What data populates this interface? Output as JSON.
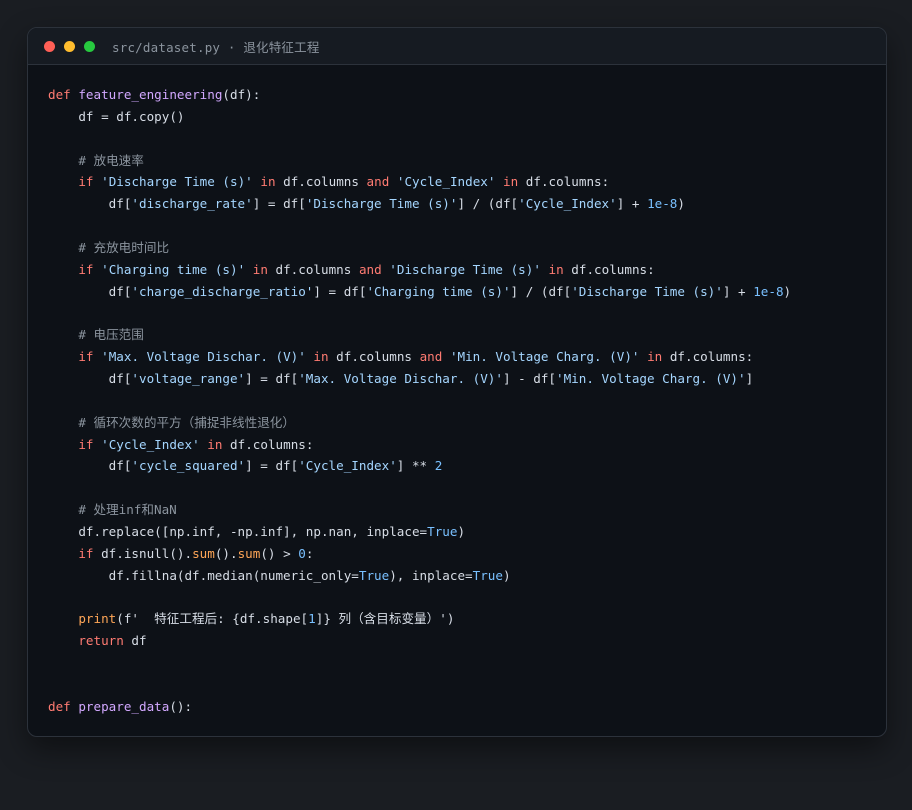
{
  "window": {
    "title": "src/dataset.py · 退化特征工程",
    "controls": {
      "close_color": "#ff5f56",
      "minimize_color": "#ffbd2e",
      "maximize_color": "#27c93f"
    }
  },
  "code_lines": [
    [
      {
        "t": "kw",
        "v": "def"
      },
      {
        "t": "plain",
        "v": " "
      },
      {
        "t": "fn",
        "v": "feature_engineering"
      },
      {
        "t": "plain",
        "v": "(df):"
      }
    ],
    [
      {
        "t": "plain",
        "v": "    df = df.copy()"
      }
    ],
    [],
    [
      {
        "t": "com",
        "v": "    # 放电速率"
      }
    ],
    [
      {
        "t": "plain",
        "v": "    "
      },
      {
        "t": "kw",
        "v": "if"
      },
      {
        "t": "plain",
        "v": " "
      },
      {
        "t": "str",
        "v": "'Discharge Time (s)'"
      },
      {
        "t": "plain",
        "v": " "
      },
      {
        "t": "kw",
        "v": "in"
      },
      {
        "t": "plain",
        "v": " df.columns "
      },
      {
        "t": "kw",
        "v": "and"
      },
      {
        "t": "plain",
        "v": " "
      },
      {
        "t": "str",
        "v": "'Cycle_Index'"
      },
      {
        "t": "plain",
        "v": " "
      },
      {
        "t": "kw",
        "v": "in"
      },
      {
        "t": "plain",
        "v": " df.columns:"
      }
    ],
    [
      {
        "t": "plain",
        "v": "        df["
      },
      {
        "t": "str",
        "v": "'discharge_rate'"
      },
      {
        "t": "plain",
        "v": "] = df["
      },
      {
        "t": "str",
        "v": "'Discharge Time (s)'"
      },
      {
        "t": "plain",
        "v": "] / (df["
      },
      {
        "t": "str",
        "v": "'Cycle_Index'"
      },
      {
        "t": "plain",
        "v": "] + "
      },
      {
        "t": "num",
        "v": "1e-8"
      },
      {
        "t": "plain",
        "v": ")"
      }
    ],
    [],
    [
      {
        "t": "com",
        "v": "    # 充放电时间比"
      }
    ],
    [
      {
        "t": "plain",
        "v": "    "
      },
      {
        "t": "kw",
        "v": "if"
      },
      {
        "t": "plain",
        "v": " "
      },
      {
        "t": "str",
        "v": "'Charging time (s)'"
      },
      {
        "t": "plain",
        "v": " "
      },
      {
        "t": "kw",
        "v": "in"
      },
      {
        "t": "plain",
        "v": " df.columns "
      },
      {
        "t": "kw",
        "v": "and"
      },
      {
        "t": "plain",
        "v": " "
      },
      {
        "t": "str",
        "v": "'Discharge Time (s)'"
      },
      {
        "t": "plain",
        "v": " "
      },
      {
        "t": "kw",
        "v": "in"
      },
      {
        "t": "plain",
        "v": " df.columns:"
      }
    ],
    [
      {
        "t": "plain",
        "v": "        df["
      },
      {
        "t": "str",
        "v": "'charge_discharge_ratio'"
      },
      {
        "t": "plain",
        "v": "] = df["
      },
      {
        "t": "str",
        "v": "'Charging time (s)'"
      },
      {
        "t": "plain",
        "v": "] / (df["
      },
      {
        "t": "str",
        "v": "'Discharge Time (s)'"
      },
      {
        "t": "plain",
        "v": "] + "
      },
      {
        "t": "num",
        "v": "1e-8"
      },
      {
        "t": "plain",
        "v": ")"
      }
    ],
    [],
    [
      {
        "t": "com",
        "v": "    # 电压范围"
      }
    ],
    [
      {
        "t": "plain",
        "v": "    "
      },
      {
        "t": "kw",
        "v": "if"
      },
      {
        "t": "plain",
        "v": " "
      },
      {
        "t": "str",
        "v": "'Max. Voltage Dischar. (V)'"
      },
      {
        "t": "plain",
        "v": " "
      },
      {
        "t": "kw",
        "v": "in"
      },
      {
        "t": "plain",
        "v": " df.columns "
      },
      {
        "t": "kw",
        "v": "and"
      },
      {
        "t": "plain",
        "v": " "
      },
      {
        "t": "str",
        "v": "'Min. Voltage Charg. (V)'"
      },
      {
        "t": "plain",
        "v": " "
      },
      {
        "t": "kw",
        "v": "in"
      },
      {
        "t": "plain",
        "v": " df.columns:"
      }
    ],
    [
      {
        "t": "plain",
        "v": "        df["
      },
      {
        "t": "str",
        "v": "'voltage_range'"
      },
      {
        "t": "plain",
        "v": "] = df["
      },
      {
        "t": "str",
        "v": "'Max. Voltage Dischar. (V)'"
      },
      {
        "t": "plain",
        "v": "] - df["
      },
      {
        "t": "str",
        "v": "'Min. Voltage Charg. (V)'"
      },
      {
        "t": "plain",
        "v": "]"
      }
    ],
    [],
    [
      {
        "t": "com",
        "v": "    # 循环次数的平方（捕捉非线性退化）"
      }
    ],
    [
      {
        "t": "plain",
        "v": "    "
      },
      {
        "t": "kw",
        "v": "if"
      },
      {
        "t": "plain",
        "v": " "
      },
      {
        "t": "str",
        "v": "'Cycle_Index'"
      },
      {
        "t": "plain",
        "v": " "
      },
      {
        "t": "kw",
        "v": "in"
      },
      {
        "t": "plain",
        "v": " df.columns:"
      }
    ],
    [
      {
        "t": "plain",
        "v": "        df["
      },
      {
        "t": "str",
        "v": "'cycle_squared'"
      },
      {
        "t": "plain",
        "v": "] = df["
      },
      {
        "t": "str",
        "v": "'Cycle_Index'"
      },
      {
        "t": "plain",
        "v": "] ** "
      },
      {
        "t": "num",
        "v": "2"
      }
    ],
    [],
    [
      {
        "t": "com",
        "v": "    # 处理inf和NaN"
      }
    ],
    [
      {
        "t": "plain",
        "v": "    df.replace([np.inf, -np.inf], np.nan, inplace="
      },
      {
        "t": "num",
        "v": "True"
      },
      {
        "t": "plain",
        "v": ")"
      }
    ],
    [
      {
        "t": "plain",
        "v": "    "
      },
      {
        "t": "kw",
        "v": "if"
      },
      {
        "t": "plain",
        "v": " df.isnull()."
      },
      {
        "t": "bi",
        "v": "sum"
      },
      {
        "t": "plain",
        "v": "()."
      },
      {
        "t": "bi",
        "v": "sum"
      },
      {
        "t": "plain",
        "v": "() > "
      },
      {
        "t": "num",
        "v": "0"
      },
      {
        "t": "plain",
        "v": ":"
      }
    ],
    [
      {
        "t": "plain",
        "v": "        df.fillna(df.median(numeric_only="
      },
      {
        "t": "num",
        "v": "True"
      },
      {
        "t": "plain",
        "v": "), inplace="
      },
      {
        "t": "num",
        "v": "True"
      },
      {
        "t": "plain",
        "v": ")"
      }
    ],
    [],
    [
      {
        "t": "plain",
        "v": "    "
      },
      {
        "t": "bi",
        "v": "print"
      },
      {
        "t": "plain",
        "v": "(f'  特征工程后: {df.shape["
      },
      {
        "t": "num",
        "v": "1"
      },
      {
        "t": "plain",
        "v": "]} 列（含目标变量）')"
      }
    ],
    [
      {
        "t": "plain",
        "v": "    "
      },
      {
        "t": "kw",
        "v": "return"
      },
      {
        "t": "plain",
        "v": " df"
      }
    ],
    [],
    [],
    [
      {
        "t": "kw",
        "v": "def"
      },
      {
        "t": "plain",
        "v": " "
      },
      {
        "t": "fn",
        "v": "prepare_data"
      },
      {
        "t": "plain",
        "v": "():"
      }
    ]
  ],
  "colors": {
    "keyword": "#ff7b72",
    "function": "#d2a8ff",
    "string": "#a5d6ff",
    "comment": "#8b949e",
    "number": "#79c0ff",
    "builtin": "#ffa657",
    "text": "#d7dde6",
    "background": "#0d1117"
  }
}
